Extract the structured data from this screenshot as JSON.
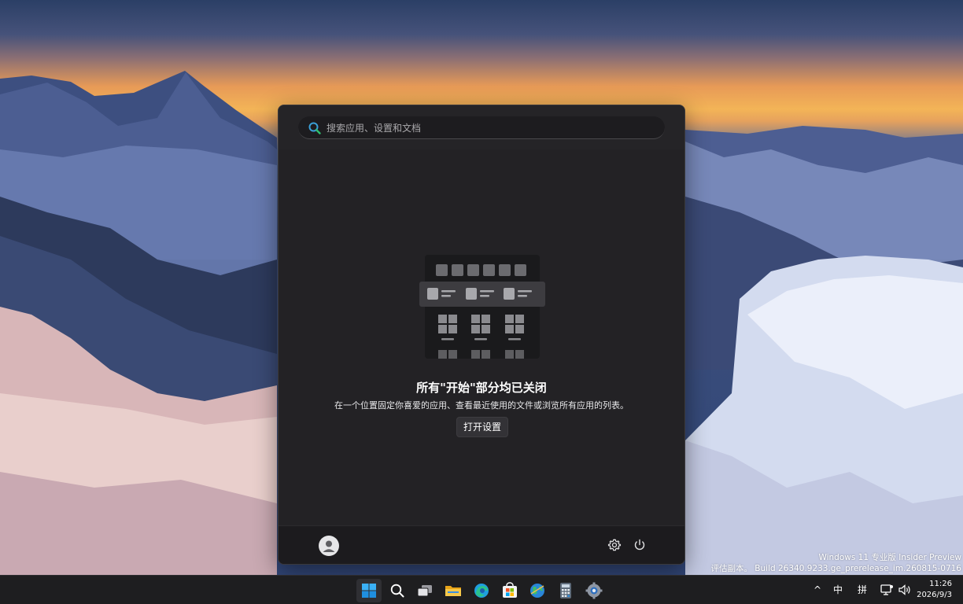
{
  "desktop": {
    "watermark": {
      "line1": "Windows 11 专业版 Insider Preview",
      "line2": "评估副本。 Build 26340.9233.ge_prerelease_im.260815-0716"
    }
  },
  "start_menu": {
    "search_placeholder": "搜索应用、设置和文档",
    "empty_title": "所有\"开始\"部分均已关闭",
    "empty_description": "在一个位置固定你喜爱的应用、查看最近使用的文件或浏览所有应用的列表。",
    "open_settings_label": "打开设置",
    "footer": {
      "user_icon": "user-avatar-icon",
      "settings_icon": "gear-icon",
      "power_icon": "power-icon"
    }
  },
  "taskbar": {
    "apps": [
      {
        "name": "start-button",
        "icon": "windows-logo-icon",
        "active": true
      },
      {
        "name": "search-button",
        "icon": "search-icon"
      },
      {
        "name": "task-view-button",
        "icon": "task-view-icon"
      },
      {
        "name": "file-explorer-button",
        "icon": "folder-icon"
      },
      {
        "name": "edge-button",
        "icon": "edge-icon"
      },
      {
        "name": "store-button",
        "icon": "store-icon"
      },
      {
        "name": "maps-button",
        "icon": "globe-icon"
      },
      {
        "name": "calculator-button",
        "icon": "calculator-icon"
      },
      {
        "name": "settings-button",
        "icon": "settings-gear-icon"
      }
    ],
    "tray": {
      "chevron": "^",
      "ime_mode": "中",
      "ime_pinyin": "拼",
      "time": "11:26",
      "date": "2026/9/3"
    }
  },
  "colors": {
    "start_bg": "#232225",
    "taskbar_bg": "#1e1e20",
    "accent": "#0078d4"
  }
}
